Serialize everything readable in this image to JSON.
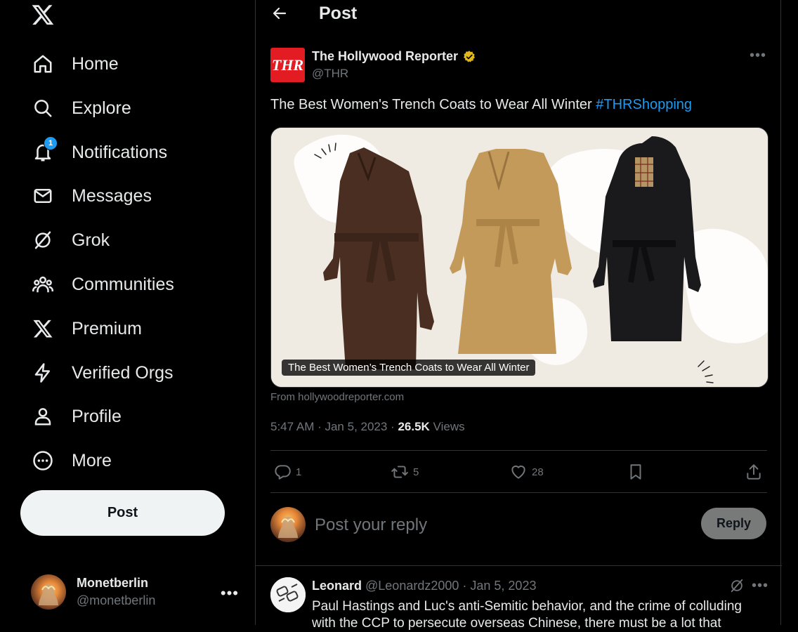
{
  "nav": {
    "items": [
      {
        "label": "Home",
        "icon": "home-icon"
      },
      {
        "label": "Explore",
        "icon": "search-icon"
      },
      {
        "label": "Notifications",
        "icon": "bell-icon",
        "badge": "1"
      },
      {
        "label": "Messages",
        "icon": "mail-icon"
      },
      {
        "label": "Grok",
        "icon": "grok-icon"
      },
      {
        "label": "Communities",
        "icon": "communities-icon"
      },
      {
        "label": "Premium",
        "icon": "x-logo-icon"
      },
      {
        "label": "Verified Orgs",
        "icon": "lightning-icon"
      },
      {
        "label": "Profile",
        "icon": "person-icon"
      },
      {
        "label": "More",
        "icon": "more-circle-icon"
      }
    ],
    "post_button": "Post",
    "account": {
      "name": "Monetberlin",
      "handle": "@monetberlin",
      "more": "•••"
    }
  },
  "header": {
    "title": "Post"
  },
  "post": {
    "avatar_text": "THR",
    "author_name": "The Hollywood Reporter",
    "author_handle": "@THR",
    "more": "•••",
    "text": "The Best Women's Trench Coats to Wear All Winter ",
    "hashtag": "#THRShopping",
    "card_caption": "The Best Women’s Trench Coats to Wear All Winter",
    "card_source": "From hollywoodreporter.com",
    "time": "5:47 AM · Jan 5, 2023 · ",
    "views_count": "26.5K",
    "views_label": " Views",
    "replies": "1",
    "reposts": "5",
    "likes": "28"
  },
  "reply_box": {
    "placeholder": "Post your reply",
    "button": "Reply"
  },
  "comment": {
    "name": "Leonard",
    "handle": " @Leonardz2000",
    "date": " · Jan 5, 2023",
    "more": "•••",
    "text": "Paul Hastings and Luc's anti-Semitic behavior, and the crime of colluding with the CCP to persecute overseas Chinese, there must be a lot that"
  },
  "colors": {
    "accent": "#1d9bf0",
    "background": "#000000",
    "border": "#2f3336",
    "muted": "#71767b",
    "text": "#e7e9ea",
    "verified": "#e2b719"
  }
}
